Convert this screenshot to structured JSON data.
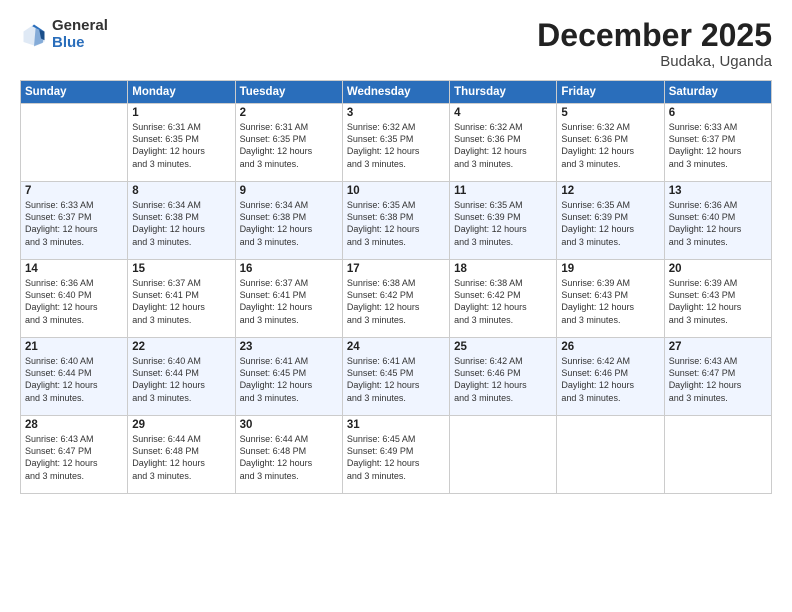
{
  "header": {
    "logo_general": "General",
    "logo_blue": "Blue",
    "month_title": "December 2025",
    "location": "Budaka, Uganda"
  },
  "weekdays": [
    "Sunday",
    "Monday",
    "Tuesday",
    "Wednesday",
    "Thursday",
    "Friday",
    "Saturday"
  ],
  "weeks": [
    [
      {
        "day": "",
        "sunrise": "",
        "sunset": "",
        "daylight": ""
      },
      {
        "day": "1",
        "sunrise": "Sunrise: 6:31 AM",
        "sunset": "Sunset: 6:35 PM",
        "daylight": "Daylight: 12 hours and 3 minutes."
      },
      {
        "day": "2",
        "sunrise": "Sunrise: 6:31 AM",
        "sunset": "Sunset: 6:35 PM",
        "daylight": "Daylight: 12 hours and 3 minutes."
      },
      {
        "day": "3",
        "sunrise": "Sunrise: 6:32 AM",
        "sunset": "Sunset: 6:35 PM",
        "daylight": "Daylight: 12 hours and 3 minutes."
      },
      {
        "day": "4",
        "sunrise": "Sunrise: 6:32 AM",
        "sunset": "Sunset: 6:36 PM",
        "daylight": "Daylight: 12 hours and 3 minutes."
      },
      {
        "day": "5",
        "sunrise": "Sunrise: 6:32 AM",
        "sunset": "Sunset: 6:36 PM",
        "daylight": "Daylight: 12 hours and 3 minutes."
      },
      {
        "day": "6",
        "sunrise": "Sunrise: 6:33 AM",
        "sunset": "Sunset: 6:37 PM",
        "daylight": "Daylight: 12 hours and 3 minutes."
      }
    ],
    [
      {
        "day": "7",
        "sunrise": "Sunrise: 6:33 AM",
        "sunset": "Sunset: 6:37 PM",
        "daylight": "Daylight: 12 hours and 3 minutes."
      },
      {
        "day": "8",
        "sunrise": "Sunrise: 6:34 AM",
        "sunset": "Sunset: 6:38 PM",
        "daylight": "Daylight: 12 hours and 3 minutes."
      },
      {
        "day": "9",
        "sunrise": "Sunrise: 6:34 AM",
        "sunset": "Sunset: 6:38 PM",
        "daylight": "Daylight: 12 hours and 3 minutes."
      },
      {
        "day": "10",
        "sunrise": "Sunrise: 6:35 AM",
        "sunset": "Sunset: 6:38 PM",
        "daylight": "Daylight: 12 hours and 3 minutes."
      },
      {
        "day": "11",
        "sunrise": "Sunrise: 6:35 AM",
        "sunset": "Sunset: 6:39 PM",
        "daylight": "Daylight: 12 hours and 3 minutes."
      },
      {
        "day": "12",
        "sunrise": "Sunrise: 6:35 AM",
        "sunset": "Sunset: 6:39 PM",
        "daylight": "Daylight: 12 hours and 3 minutes."
      },
      {
        "day": "13",
        "sunrise": "Sunrise: 6:36 AM",
        "sunset": "Sunset: 6:40 PM",
        "daylight": "Daylight: 12 hours and 3 minutes."
      }
    ],
    [
      {
        "day": "14",
        "sunrise": "Sunrise: 6:36 AM",
        "sunset": "Sunset: 6:40 PM",
        "daylight": "Daylight: 12 hours and 3 minutes."
      },
      {
        "day": "15",
        "sunrise": "Sunrise: 6:37 AM",
        "sunset": "Sunset: 6:41 PM",
        "daylight": "Daylight: 12 hours and 3 minutes."
      },
      {
        "day": "16",
        "sunrise": "Sunrise: 6:37 AM",
        "sunset": "Sunset: 6:41 PM",
        "daylight": "Daylight: 12 hours and 3 minutes."
      },
      {
        "day": "17",
        "sunrise": "Sunrise: 6:38 AM",
        "sunset": "Sunset: 6:42 PM",
        "daylight": "Daylight: 12 hours and 3 minutes."
      },
      {
        "day": "18",
        "sunrise": "Sunrise: 6:38 AM",
        "sunset": "Sunset: 6:42 PM",
        "daylight": "Daylight: 12 hours and 3 minutes."
      },
      {
        "day": "19",
        "sunrise": "Sunrise: 6:39 AM",
        "sunset": "Sunset: 6:43 PM",
        "daylight": "Daylight: 12 hours and 3 minutes."
      },
      {
        "day": "20",
        "sunrise": "Sunrise: 6:39 AM",
        "sunset": "Sunset: 6:43 PM",
        "daylight": "Daylight: 12 hours and 3 minutes."
      }
    ],
    [
      {
        "day": "21",
        "sunrise": "Sunrise: 6:40 AM",
        "sunset": "Sunset: 6:44 PM",
        "daylight": "Daylight: 12 hours and 3 minutes."
      },
      {
        "day": "22",
        "sunrise": "Sunrise: 6:40 AM",
        "sunset": "Sunset: 6:44 PM",
        "daylight": "Daylight: 12 hours and 3 minutes."
      },
      {
        "day": "23",
        "sunrise": "Sunrise: 6:41 AM",
        "sunset": "Sunset: 6:45 PM",
        "daylight": "Daylight: 12 hours and 3 minutes."
      },
      {
        "day": "24",
        "sunrise": "Sunrise: 6:41 AM",
        "sunset": "Sunset: 6:45 PM",
        "daylight": "Daylight: 12 hours and 3 minutes."
      },
      {
        "day": "25",
        "sunrise": "Sunrise: 6:42 AM",
        "sunset": "Sunset: 6:46 PM",
        "daylight": "Daylight: 12 hours and 3 minutes."
      },
      {
        "day": "26",
        "sunrise": "Sunrise: 6:42 AM",
        "sunset": "Sunset: 6:46 PM",
        "daylight": "Daylight: 12 hours and 3 minutes."
      },
      {
        "day": "27",
        "sunrise": "Sunrise: 6:43 AM",
        "sunset": "Sunset: 6:47 PM",
        "daylight": "Daylight: 12 hours and 3 minutes."
      }
    ],
    [
      {
        "day": "28",
        "sunrise": "Sunrise: 6:43 AM",
        "sunset": "Sunset: 6:47 PM",
        "daylight": "Daylight: 12 hours and 3 minutes."
      },
      {
        "day": "29",
        "sunrise": "Sunrise: 6:44 AM",
        "sunset": "Sunset: 6:48 PM",
        "daylight": "Daylight: 12 hours and 3 minutes."
      },
      {
        "day": "30",
        "sunrise": "Sunrise: 6:44 AM",
        "sunset": "Sunset: 6:48 PM",
        "daylight": "Daylight: 12 hours and 3 minutes."
      },
      {
        "day": "31",
        "sunrise": "Sunrise: 6:45 AM",
        "sunset": "Sunset: 6:49 PM",
        "daylight": "Daylight: 12 hours and 3 minutes."
      },
      {
        "day": "",
        "sunrise": "",
        "sunset": "",
        "daylight": ""
      },
      {
        "day": "",
        "sunrise": "",
        "sunset": "",
        "daylight": ""
      },
      {
        "day": "",
        "sunrise": "",
        "sunset": "",
        "daylight": ""
      }
    ]
  ]
}
